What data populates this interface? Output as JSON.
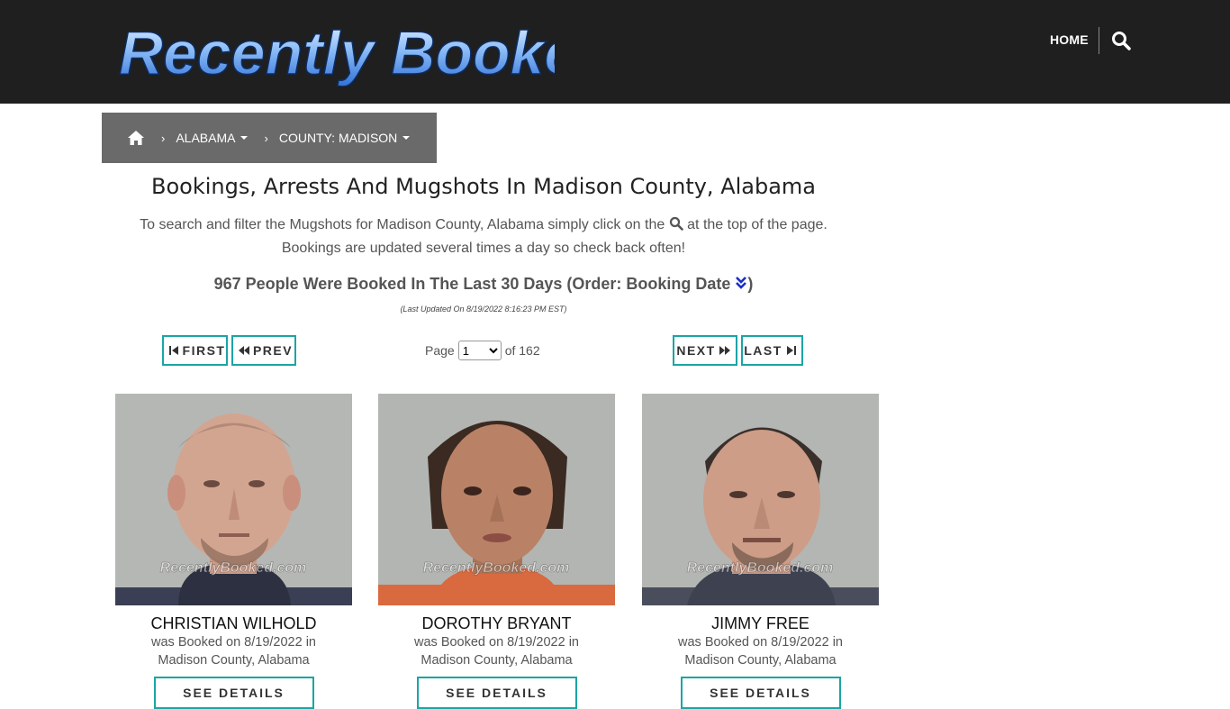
{
  "brand": {
    "logo_text": "Recently Booked"
  },
  "nav": {
    "home_label": "HOME"
  },
  "breadcrumb": {
    "items": [
      {
        "label": "ALABAMA"
      },
      {
        "label": "COUNTY: MADISON"
      }
    ]
  },
  "main": {
    "title": "Bookings, Arrests And Mugshots In Madison County, Alabama",
    "intro_line1_pre": "To search and filter the Mugshots for Madison County, Alabama simply click on the",
    "intro_line1_post": "at the top of the page.",
    "intro_line2": "Bookings are updated several times a day so check back often!",
    "count_text": "967 People Were Booked In The Last 30 Days (Order: Booking Date",
    "count_close": ")",
    "last_updated": "(Last Updated On 8/19/2022 8:16:23 PM EST)"
  },
  "pagination": {
    "first_label": "FIRST",
    "prev_label": "PREV",
    "next_label": "NEXT",
    "last_label": "LAST",
    "page_label": "Page",
    "current_page": "1",
    "of_label": "of 162"
  },
  "watermark": "RecentlyBooked.com",
  "cards": [
    {
      "name": "CHRISTIAN WILHOLD",
      "booked_line1": "was Booked on 8/19/2022 in",
      "booked_line2": "Madison County, Alabama",
      "button": "SEE DETAILS"
    },
    {
      "name": "DOROTHY BRYANT",
      "booked_line1": "was Booked on 8/19/2022 in",
      "booked_line2": "Madison County, Alabama",
      "button": "SEE DETAILS"
    },
    {
      "name": "JIMMY FREE",
      "booked_line1": "was Booked on 8/19/2022 in",
      "booked_line2": "Madison County, Alabama",
      "button": "SEE DETAILS"
    }
  ],
  "colors": {
    "header_bg": "#1f1f1f",
    "breadcrumb_bg": "#6a6a6a",
    "accent_teal": "#1aa5a5",
    "logo_blue": "#5b9bf0"
  },
  "icons": [
    "home-icon",
    "search-icon",
    "chevron-right-icon",
    "caret-down-icon",
    "double-chevron-down-icon",
    "skip-first-icon",
    "rewind-icon",
    "fast-forward-icon",
    "skip-last-icon"
  ]
}
